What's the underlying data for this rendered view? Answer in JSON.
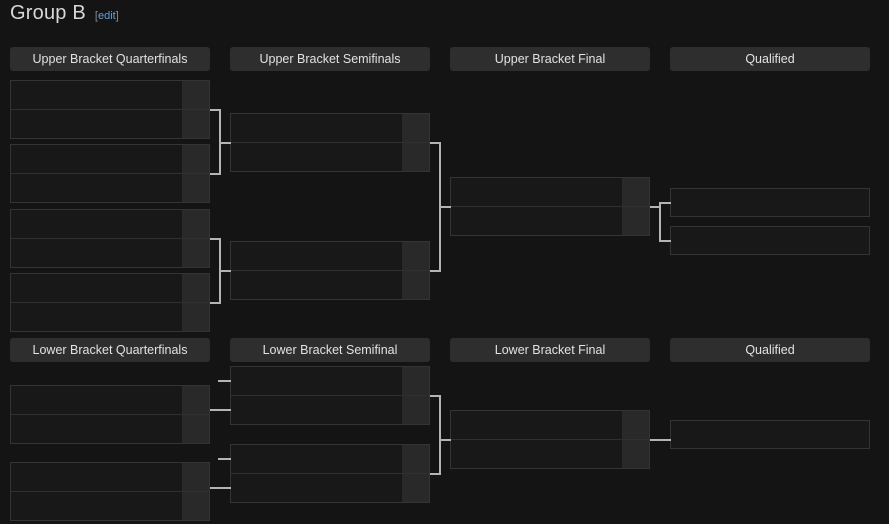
{
  "page": {
    "title": "Group B",
    "edit_label": "edit",
    "edit_bracket_open": "[",
    "edit_bracket_close": "]",
    "background_color": "#141414",
    "link_color": "#6b9fd4",
    "connector_color": "#b4b4b4",
    "header_color": "#2e2e2e"
  },
  "upper_bracket": {
    "headers": [
      {
        "label": "Upper Bracket Quarterfinals"
      },
      {
        "label": "Upper Bracket Semifinals"
      },
      {
        "label": "Upper Bracket Final"
      },
      {
        "label": "Qualified"
      }
    ],
    "quarterfinals": [
      {
        "top": {
          "team": "",
          "score": ""
        },
        "bottom": {
          "team": "",
          "score": ""
        }
      },
      {
        "top": {
          "team": "",
          "score": ""
        },
        "bottom": {
          "team": "",
          "score": ""
        }
      },
      {
        "top": {
          "team": "",
          "score": ""
        },
        "bottom": {
          "team": "",
          "score": ""
        }
      },
      {
        "top": {
          "team": "",
          "score": ""
        },
        "bottom": {
          "team": "",
          "score": ""
        }
      }
    ],
    "semifinals": [
      {
        "top": {
          "team": "",
          "score": ""
        },
        "bottom": {
          "team": "",
          "score": ""
        }
      },
      {
        "top": {
          "team": "",
          "score": ""
        },
        "bottom": {
          "team": "",
          "score": ""
        }
      }
    ],
    "final": [
      {
        "top": {
          "team": "",
          "score": ""
        },
        "bottom": {
          "team": "",
          "score": ""
        }
      }
    ],
    "qualified": [
      {
        "team": ""
      },
      {
        "team": ""
      }
    ]
  },
  "lower_bracket": {
    "headers": [
      {
        "label": "Lower Bracket Quarterfinals"
      },
      {
        "label": "Lower Bracket Semifinal"
      },
      {
        "label": "Lower Bracket Final"
      },
      {
        "label": "Qualified"
      }
    ],
    "quarterfinals": [
      {
        "top": {
          "team": "",
          "score": ""
        },
        "bottom": {
          "team": "",
          "score": ""
        }
      },
      {
        "top": {
          "team": "",
          "score": ""
        },
        "bottom": {
          "team": "",
          "score": ""
        }
      }
    ],
    "semifinals": [
      {
        "top": {
          "team": "",
          "score": ""
        },
        "bottom": {
          "team": "",
          "score": ""
        }
      },
      {
        "top": {
          "team": "",
          "score": ""
        },
        "bottom": {
          "team": "",
          "score": ""
        }
      }
    ],
    "final": [
      {
        "top": {
          "team": "",
          "score": ""
        },
        "bottom": {
          "team": "",
          "score": ""
        }
      }
    ],
    "qualified": [
      {
        "team": ""
      }
    ]
  }
}
